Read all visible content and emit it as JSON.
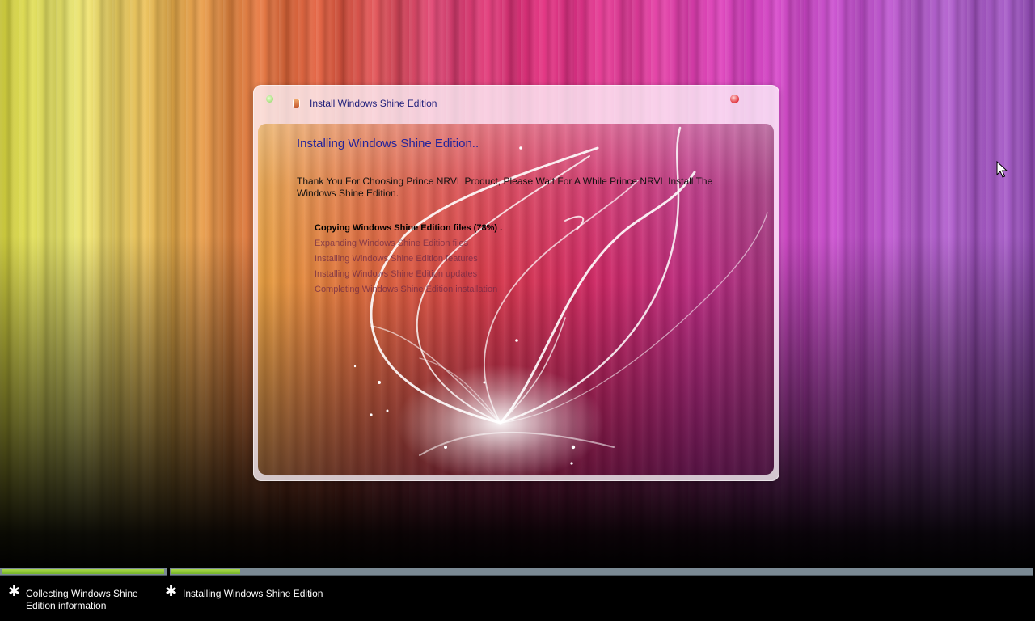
{
  "window": {
    "title": "Install Windows Shine Edition",
    "heading": "Installing Windows Shine Edition..",
    "intro": "Thank You For Choosing Prince NRVL Product, Please Wait For A While Prince NRVL Install The Windows Shine Edition.",
    "steps": [
      {
        "label": "Copying Windows Shine Edition files (78%) .",
        "state": "active"
      },
      {
        "label": "Expanding Windows Shine Edition files",
        "state": "pending"
      },
      {
        "label": "Installing Windows Shine Edition features",
        "state": "pending"
      },
      {
        "label": "Installing Windows Shine Edition updates",
        "state": "pending"
      },
      {
        "label": "Completing Windows Shine Edition installation",
        "state": "pending"
      }
    ],
    "copy_progress_percent": 78
  },
  "status_bar": {
    "stages": [
      {
        "label": "Collecting Windows Shine Edition information",
        "progress_fraction": 0.99
      },
      {
        "label": "Installing Windows Shine Edition",
        "progress_fraction": 0.08
      }
    ]
  },
  "icons": {
    "window_icon": "setup-icon",
    "close": "close-icon",
    "bullet": "asterisk-icon",
    "pointer": "mouse-pointer-icon"
  },
  "colors": {
    "progress_fill": "#8cc63f",
    "progress_track": "#7b8a94",
    "title_text": "#1d1d7a",
    "heading_text": "#23239a"
  }
}
